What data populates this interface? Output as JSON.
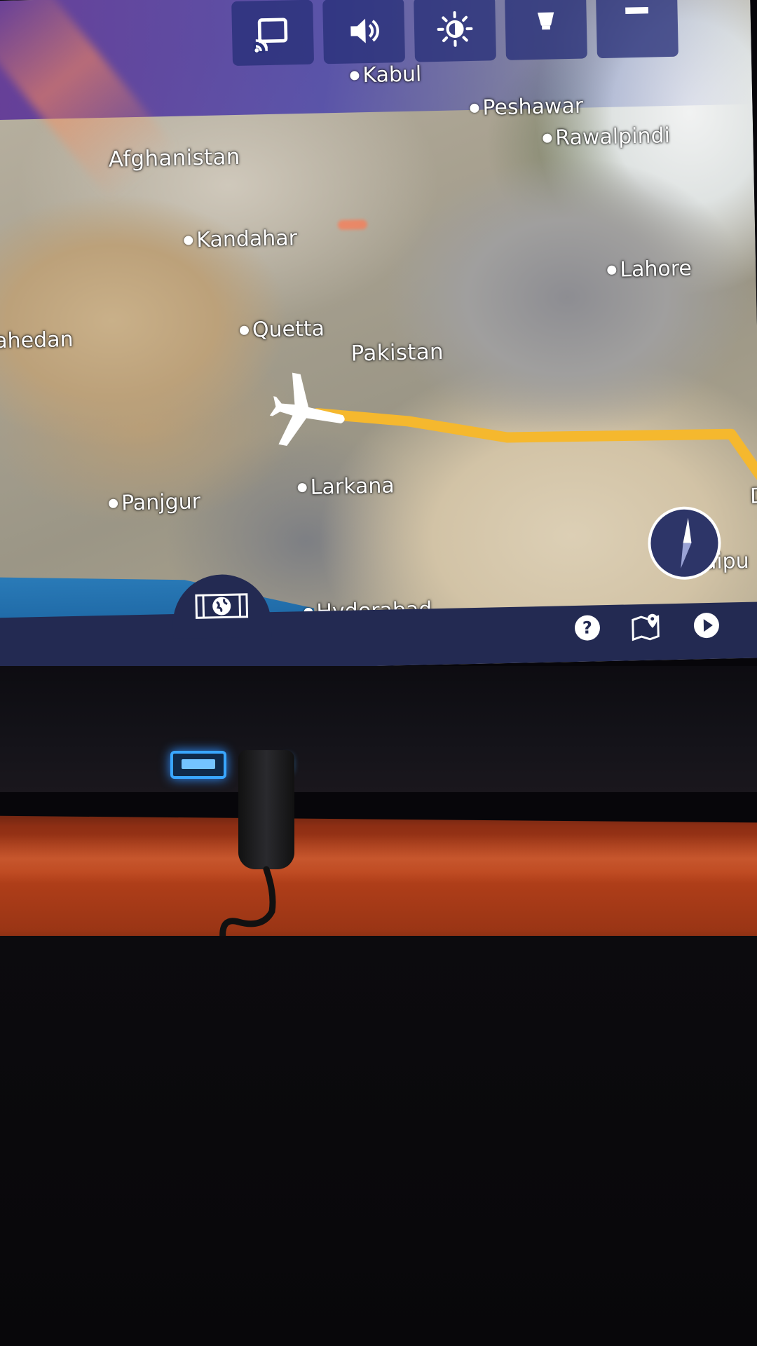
{
  "map": {
    "countries": [
      {
        "id": "afghanistan",
        "label": "Afghanistan"
      },
      {
        "id": "pakistan",
        "label": "Pakistan"
      }
    ],
    "cities": [
      {
        "id": "kabul",
        "label": "Kabul"
      },
      {
        "id": "peshawar",
        "label": "Peshawar"
      },
      {
        "id": "rawalpindi",
        "label": "Rawalpindi"
      },
      {
        "id": "kandahar",
        "label": "Kandahar"
      },
      {
        "id": "lahore",
        "label": "Lahore"
      },
      {
        "id": "zahedan",
        "label": "ahedan"
      },
      {
        "id": "quetta",
        "label": "Quetta"
      },
      {
        "id": "larkana",
        "label": "Larkana"
      },
      {
        "id": "panjgur",
        "label": "Panjgur"
      },
      {
        "id": "hyderabad",
        "label": "Hyderabad"
      },
      {
        "id": "jaipur",
        "label": "Jaipu"
      },
      {
        "id": "delhi",
        "label": "D"
      }
    ],
    "route_color": "#f5b82e"
  },
  "controls": {
    "top": [
      {
        "id": "cast",
        "icon": "cast-icon"
      },
      {
        "id": "volume",
        "icon": "volume-icon"
      },
      {
        "id": "brightness",
        "icon": "brightness-icon"
      },
      {
        "id": "light",
        "icon": "reading-light-icon"
      },
      {
        "id": "extra",
        "icon": "menu-icon"
      }
    ],
    "bottom": [
      {
        "id": "globe",
        "icon": "globe-icon"
      },
      {
        "id": "help",
        "icon": "help-icon"
      },
      {
        "id": "map-view",
        "icon": "map-pin-icon"
      },
      {
        "id": "play",
        "icon": "play-icon"
      }
    ],
    "compass": "compass-icon"
  },
  "colors": {
    "bar": "#232a52",
    "top_button": "#28307a",
    "usb_light": "#39a6ff",
    "panel": "#b4401a"
  }
}
